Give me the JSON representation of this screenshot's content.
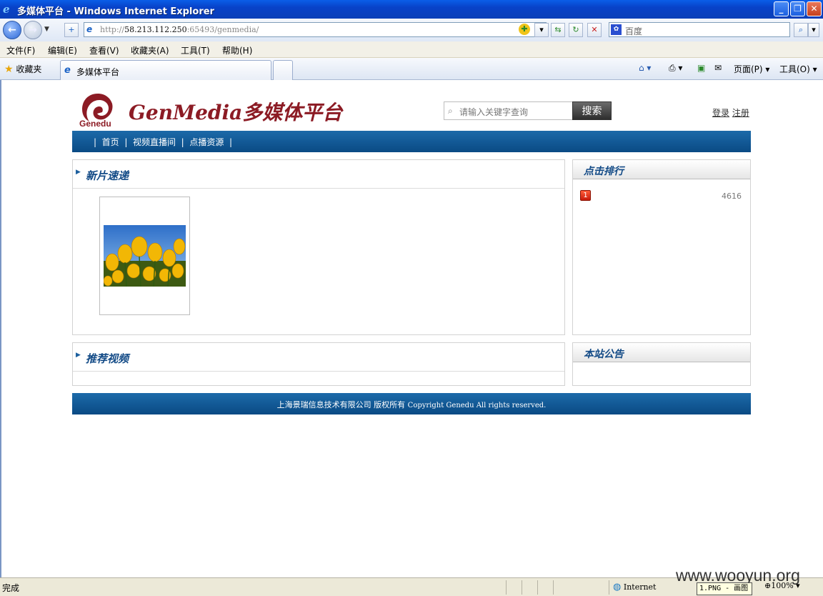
{
  "window": {
    "title": "多媒体平台 - Windows Internet Explorer"
  },
  "address": {
    "url_prefix": "http://",
    "url_host": "58.213.112.250",
    "url_rest": ":65493/genmedia/"
  },
  "search": {
    "placeholder": "百度"
  },
  "menu": {
    "items": [
      "文件(F)",
      "编辑(E)",
      "查看(V)",
      "收藏夹(A)",
      "工具(T)",
      "帮助(H)"
    ]
  },
  "favorites": {
    "label": "收藏夹",
    "tab_title": "多媒体平台",
    "page_menu": "页面(P)",
    "tools_menu": "工具(O)"
  },
  "site": {
    "logo_word": "Genedu",
    "brand": "GenMedia多媒体平台",
    "search_placeholder": "请输入关键字查询",
    "search_button": "搜索",
    "login": "登录",
    "register": "注册",
    "nav": [
      "首页",
      "视频直播间",
      "点播资源"
    ],
    "news_title": "新片速递",
    "recommend_title": "推荐视频",
    "ranking_title": "点击排行",
    "notice_title": "本站公告",
    "ranking": [
      {
        "rank": "1",
        "count": "4616"
      }
    ],
    "footer_cn": "上海景瑞信息技术有限公司 版权所有",
    "footer_en": "Copyright Genedu All rights reserved."
  },
  "status": {
    "text": "完成",
    "zone": "Internet",
    "taskbar_popup": "1.PNG - 画图",
    "zoom": "100%",
    "watermark": "www.wooyun.org"
  },
  "colors": {
    "brand_red": "#8c1b24",
    "nav_blue": "#0a4a84",
    "heading_blue": "#124a86"
  }
}
